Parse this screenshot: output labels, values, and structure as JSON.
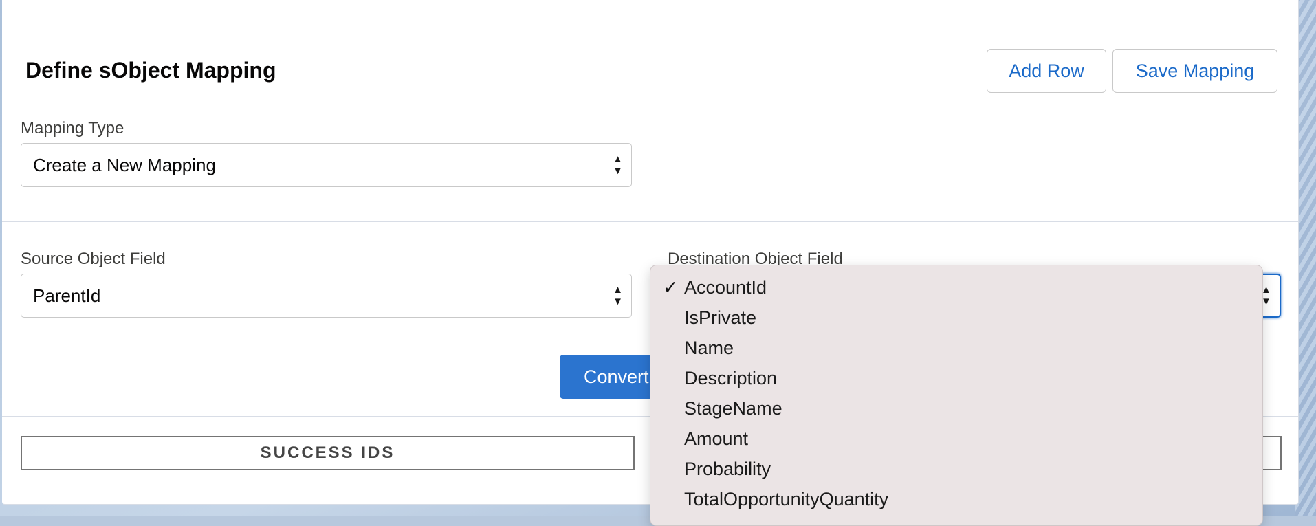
{
  "card": {
    "title": "Define sObject Mapping",
    "add_row_label": "Add Row",
    "save_mapping_label": "Save Mapping"
  },
  "mapping_type": {
    "label": "Mapping Type",
    "value": "Create a New Mapping"
  },
  "source_field": {
    "label": "Source Object Field",
    "value": "ParentId"
  },
  "destination_field": {
    "label": "Destination Object Field",
    "value": "AccountId"
  },
  "convert_label": "Convert",
  "results": {
    "success_label": "SUCCESS IDS"
  },
  "dropdown": {
    "selected_index": 0,
    "options": [
      {
        "label": "AccountId",
        "checked": true
      },
      {
        "label": "IsPrivate",
        "checked": false
      },
      {
        "label": "Name",
        "checked": false
      },
      {
        "label": "Description",
        "checked": false
      },
      {
        "label": "StageName",
        "checked": false
      },
      {
        "label": "Amount",
        "checked": false
      },
      {
        "label": "Probability",
        "checked": false
      },
      {
        "label": "TotalOpportunityQuantity",
        "checked": false
      }
    ]
  },
  "colors": {
    "brand": "#2b74cf",
    "link": "#1b6ac9",
    "dropdown_bg": "#ebe4e5"
  }
}
